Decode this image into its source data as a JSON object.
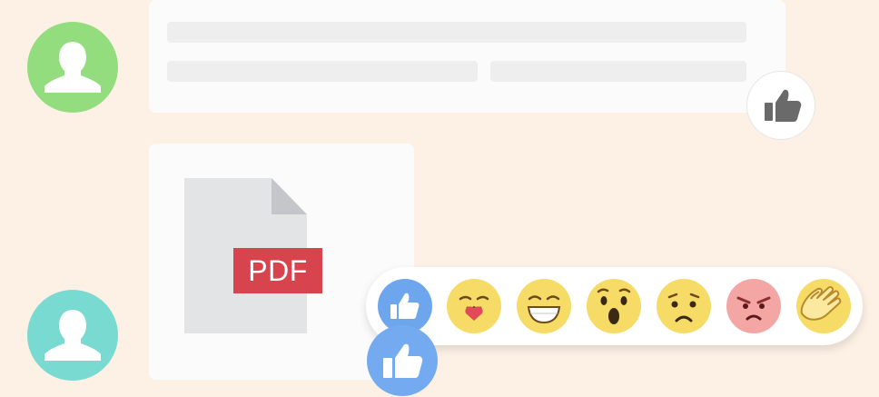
{
  "conversation": {
    "messages": [
      {
        "sender_avatar_color": "#93dd7f",
        "type": "text-placeholder",
        "reaction": "like",
        "reaction_state": "default"
      },
      {
        "sender_avatar_color": "#79dad1",
        "type": "file",
        "file_type_label": "PDF",
        "reaction": "like",
        "reaction_state": "selected"
      }
    ]
  },
  "reaction_picker": {
    "options": [
      {
        "name": "like-icon",
        "color": "#6ea6ee"
      },
      {
        "name": "love-kiss-face-icon",
        "color": "#f6db66"
      },
      {
        "name": "grin-face-icon",
        "color": "#f6db66"
      },
      {
        "name": "wow-face-icon",
        "color": "#f6db66"
      },
      {
        "name": "sad-face-icon",
        "color": "#f6db66"
      },
      {
        "name": "angry-face-icon",
        "color": "#f3a6a4"
      },
      {
        "name": "clap-hands-icon",
        "color": "#f6db66"
      }
    ]
  },
  "colors": {
    "background": "#fdf1e5",
    "card": "#fcfbfb",
    "pdf_badge": "#d8444d",
    "like_selected": "#74aaf0"
  }
}
